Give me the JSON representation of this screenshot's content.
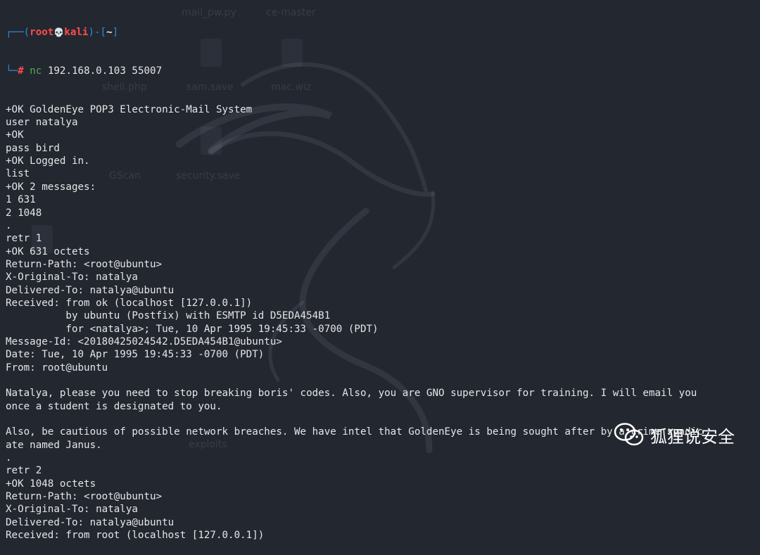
{
  "prompt": {
    "open": "┌──(",
    "user": "root",
    "skull": "💀",
    "host": "kali",
    "mid": ")-[",
    "cwd": "~",
    "close": "]",
    "corner": "└─",
    "hash": "#",
    "command": "nc",
    "args": " 192.168.0.103 55007"
  },
  "lines": [
    "+OK GoldenEye POP3 Electronic-Mail System",
    "user natalya",
    "+OK",
    "pass bird",
    "+OK Logged in.",
    "list",
    "+OK 2 messages:",
    "1 631",
    "2 1048",
    ".",
    "retr 1",
    "+OK 631 octets",
    "Return-Path: <root@ubuntu>",
    "X-Original-To: natalya",
    "Delivered-To: natalya@ubuntu",
    "Received: from ok (localhost [127.0.0.1])",
    "          by ubuntu (Postfix) with ESMTP id D5EDA454B1",
    "          for <natalya>; Tue, 10 Apr 1995 19:45:33 -0700 (PDT)",
    "Message-Id: <20180425024542.D5EDA454B1@ubuntu>",
    "Date: Tue, 10 Apr 1995 19:45:33 -0700 (PDT)",
    "From: root@ubuntu",
    "",
    "Natalya, please you need to stop breaking boris' codes. Also, you are GNO supervisor for training. I will email you",
    "once a student is designated to you.",
    "",
    "Also, be cautious of possible network breaches. We have intel that GoldenEye is being sought after by a crime syndic",
    "ate named Janus.",
    ".",
    "retr 2",
    "+OK 1048 octets",
    "Return-Path: <root@ubuntu>",
    "X-Original-To: natalya",
    "Delivered-To: natalya@ubuntu",
    "Received: from root (localhost [127.0.0.1])"
  ],
  "desktop_icons": [
    "mail_pw.py",
    "ce-master",
    "shell.php",
    "sam.save",
    "mac.wiz",
    "GScan",
    "security.save",
    "exploits"
  ],
  "watermark": {
    "icon": "wechat-icon",
    "text": "狐狸说安全"
  },
  "colors": {
    "background": "#232730",
    "text": "#e6e6e6",
    "prompt_blue": "#2f8bd6",
    "prompt_red": "#ff4d4d",
    "command_green": "#4fae4f"
  }
}
